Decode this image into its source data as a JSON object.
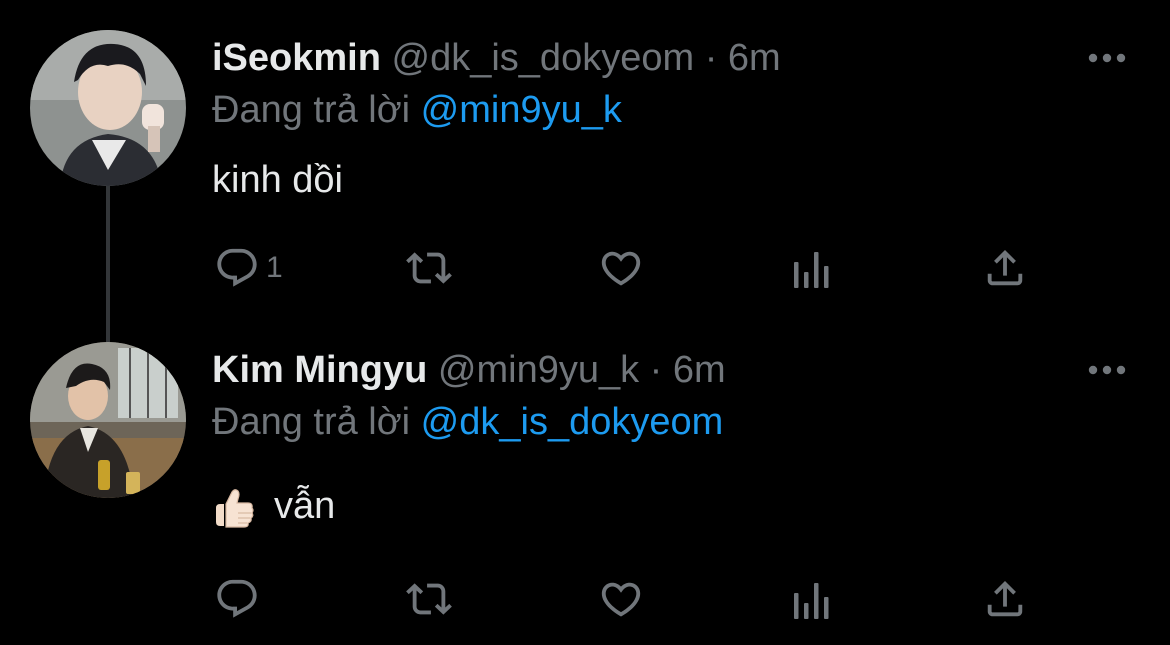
{
  "tweets": [
    {
      "name": "iSeokmin",
      "handle": "@dk_is_dokyeom",
      "separator": "·",
      "time": "6m",
      "replying_prefix": "Đang trả lời",
      "replying_to": "@min9yu_k",
      "text": "kinh dồi",
      "reply_count": "1"
    },
    {
      "name": "Kim Mingyu",
      "handle": "@min9yu_k",
      "separator": "·",
      "time": "6m",
      "replying_prefix": "Đang trả lời",
      "replying_to": "@dk_is_dokyeom",
      "emoji": "👍🏻",
      "text": "vẫn",
      "reply_count": ""
    }
  ],
  "icons": [
    "more-icon",
    "reply-icon",
    "retweet-icon",
    "like-icon",
    "views-icon",
    "share-icon"
  ],
  "colors": {
    "background": "#000000",
    "text": "#e7e9ea",
    "secondary": "#71767b",
    "link": "#1d9bf0",
    "thread_line": "#333639"
  }
}
